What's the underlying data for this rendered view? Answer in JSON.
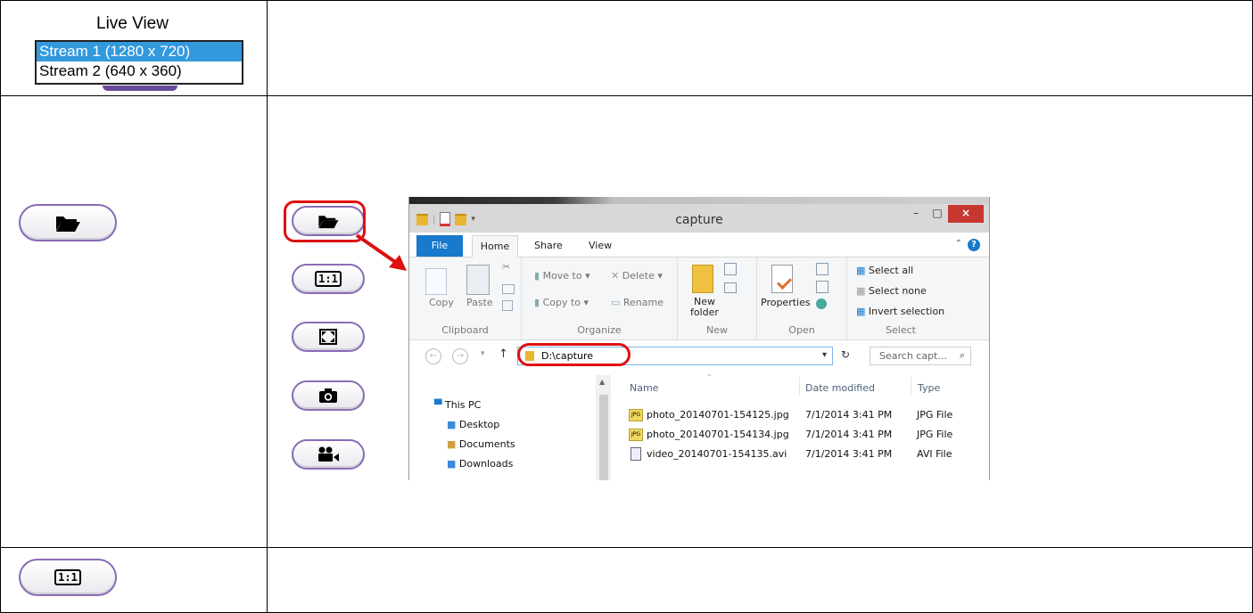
{
  "live_view": {
    "title": "Live View",
    "options": [
      "Stream 1 (1280 x 720)",
      "Stream 2 (640 x 360)"
    ],
    "selected": "Stream 1 (1280 x 720)"
  },
  "buttons": {
    "open_folder": "folder-open-icon",
    "actual_size_label": "1:1",
    "fullscreen": "fullscreen-icon",
    "snapshot": "camera-icon",
    "record": "video-camera-icon"
  },
  "explorer": {
    "window_title": "capture",
    "tabs": [
      "File",
      "Home",
      "Share",
      "View"
    ],
    "clipboard": {
      "copy": "Copy",
      "paste": "Paste",
      "group": "Clipboard"
    },
    "organize": {
      "move_to": "Move to",
      "copy_to": "Copy to",
      "delete": "Delete",
      "rename": "Rename",
      "group": "Organize"
    },
    "new": {
      "new_folder_line1": "New",
      "new_folder_line2": "folder",
      "group": "New"
    },
    "open": {
      "properties": "Properties",
      "group": "Open"
    },
    "select": {
      "select_all": "Select all",
      "select_none": "Select none",
      "invert": "Invert selection",
      "group": "Select"
    },
    "address": "D:\\capture",
    "search_placeholder": "Search capt...",
    "nav": [
      "This PC",
      "Desktop",
      "Documents",
      "Downloads"
    ],
    "columns": {
      "name": "Name",
      "date": "Date modified",
      "type": "Type"
    },
    "files": [
      {
        "name": "photo_20140701-154125.jpg",
        "date": "7/1/2014 3:41 PM",
        "type": "JPG File"
      },
      {
        "name": "photo_20140701-154134.jpg",
        "date": "7/1/2014 3:41 PM",
        "type": "JPG File"
      },
      {
        "name": "video_20140701-154135.avi",
        "date": "7/1/2014 3:41 PM",
        "type": "AVI File"
      }
    ]
  },
  "colors": {
    "accent": "#1979ca",
    "highlight": "#e01010",
    "pill_border": "#8a6bb5"
  }
}
